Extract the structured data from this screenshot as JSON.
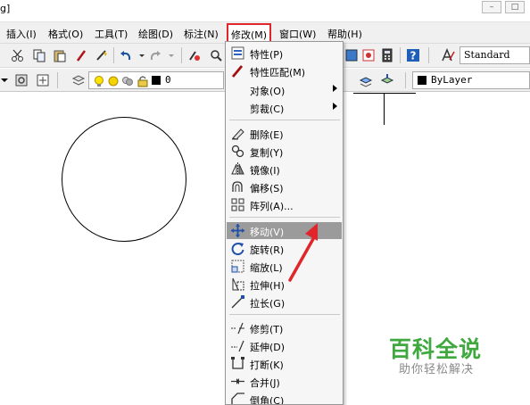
{
  "window": {
    "title_fragment": "g]",
    "buttons": [
      "–",
      "□"
    ]
  },
  "menubar": {
    "items": [
      {
        "label": "插入(I)"
      },
      {
        "label": "格式(O)"
      },
      {
        "label": "工具(T)"
      },
      {
        "label": "绘图(D)"
      },
      {
        "label": "标注(N)"
      },
      {
        "label": "修改(M)"
      },
      {
        "label": "窗口(W)"
      },
      {
        "label": "帮助(H)"
      }
    ],
    "active_index": 5
  },
  "toolbar": {
    "text_style": "Standard",
    "layer_value": "0",
    "color_value": "ByLayer"
  },
  "modify_menu": {
    "groups": [
      [
        {
          "label": "特性(P)",
          "icon": "properties-icon"
        },
        {
          "label": "特性匹配(M)",
          "icon": "match-properties-icon"
        },
        {
          "label": "对象(O)",
          "icon": "",
          "submenu": true
        },
        {
          "label": "剪裁(C)",
          "icon": "",
          "submenu": true
        }
      ],
      [
        {
          "label": "删除(E)",
          "icon": "erase-icon"
        },
        {
          "label": "复制(Y)",
          "icon": "copy-icon"
        },
        {
          "label": "镜像(I)",
          "icon": "mirror-icon"
        },
        {
          "label": "偏移(S)",
          "icon": "offset-icon"
        },
        {
          "label": "阵列(A)...",
          "icon": "array-icon"
        }
      ],
      [
        {
          "label": "移动(V)",
          "icon": "move-icon",
          "highlighted": true
        },
        {
          "label": "旋转(R)",
          "icon": "rotate-icon"
        },
        {
          "label": "缩放(L)",
          "icon": "scale-icon"
        },
        {
          "label": "拉伸(H)",
          "icon": "stretch-icon"
        },
        {
          "label": "拉长(G)",
          "icon": "lengthen-icon"
        }
      ],
      [
        {
          "label": "修剪(T)",
          "icon": "trim-icon"
        },
        {
          "label": "延伸(D)",
          "icon": "extend-icon"
        },
        {
          "label": "打断(K)",
          "icon": "break-icon"
        },
        {
          "label": "合并(J)",
          "icon": "join-icon"
        },
        {
          "label": "倒角(C)",
          "icon": "chamfer-icon"
        }
      ]
    ]
  },
  "watermark": {
    "logo": "百科全说",
    "sub": "助你轻松解决"
  },
  "colors": {
    "highlight": "#9b9b9b",
    "active_border": "#e0262a",
    "arrow": "#e0262a",
    "watermark_green": "#3fa93f"
  }
}
